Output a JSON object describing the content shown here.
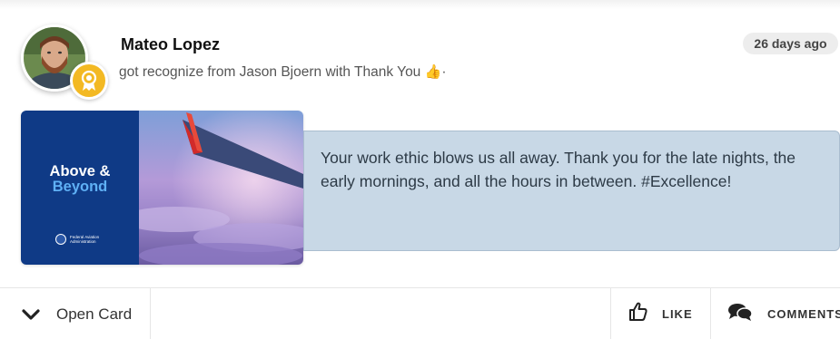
{
  "post": {
    "user_name": "Mateo Lopez",
    "activity_text": "got recognize from Jason Bjoern with Thank You",
    "activity_emoji": "👍",
    "activity_suffix": "·",
    "time_ago": "26 days ago",
    "avatar_icon": "user-avatar",
    "badge_icon": "award-badge-icon"
  },
  "ecard": {
    "title_line1": "Above &",
    "title_line2": "Beyond",
    "org_name": "Federal Aviation Administration",
    "brand_color": "#0f3a86",
    "accent_color": "#5fb0f5"
  },
  "message": {
    "text": "Your work ethic blows us all away. Thank you for the late nights, the early mornings, and all the hours in between. #Excellence!",
    "background_color": "#c8d8e6"
  },
  "footer": {
    "open_card_label": "Open Card",
    "like_label": "LIKE",
    "comments_label": "COMMENTS"
  }
}
